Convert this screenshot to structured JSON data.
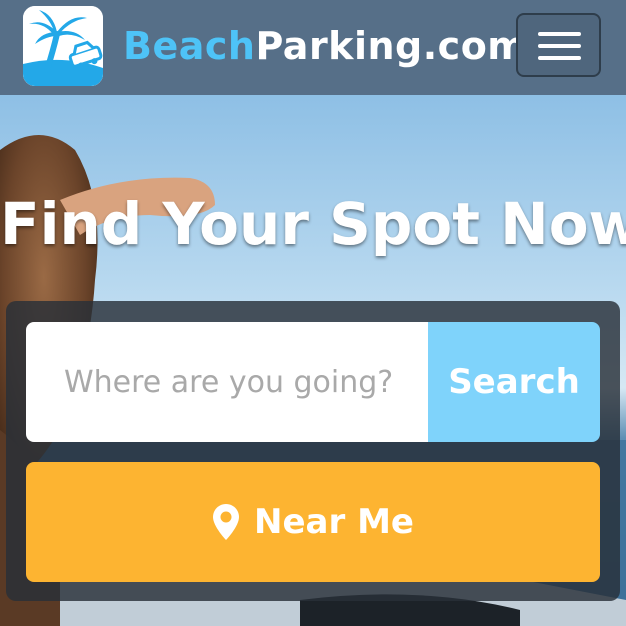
{
  "header": {
    "brand_prefix": "Beach",
    "brand_suffix": "Parking.com",
    "logo_icon": "palm-tree-car-icon",
    "menu_icon": "hamburger-menu-icon"
  },
  "hero": {
    "headline": "Find Your Spot Now"
  },
  "search": {
    "placeholder": "Where are you going?",
    "value": "",
    "button_label": "Search"
  },
  "near_me": {
    "label": "Near Me",
    "icon": "location-pin-icon"
  },
  "colors": {
    "header_bg": "#566f88",
    "brand_accent": "#4ec3f7",
    "search_button": "#7fd3fb",
    "near_me_button": "#fdb431",
    "panel_bg": "#283038"
  }
}
